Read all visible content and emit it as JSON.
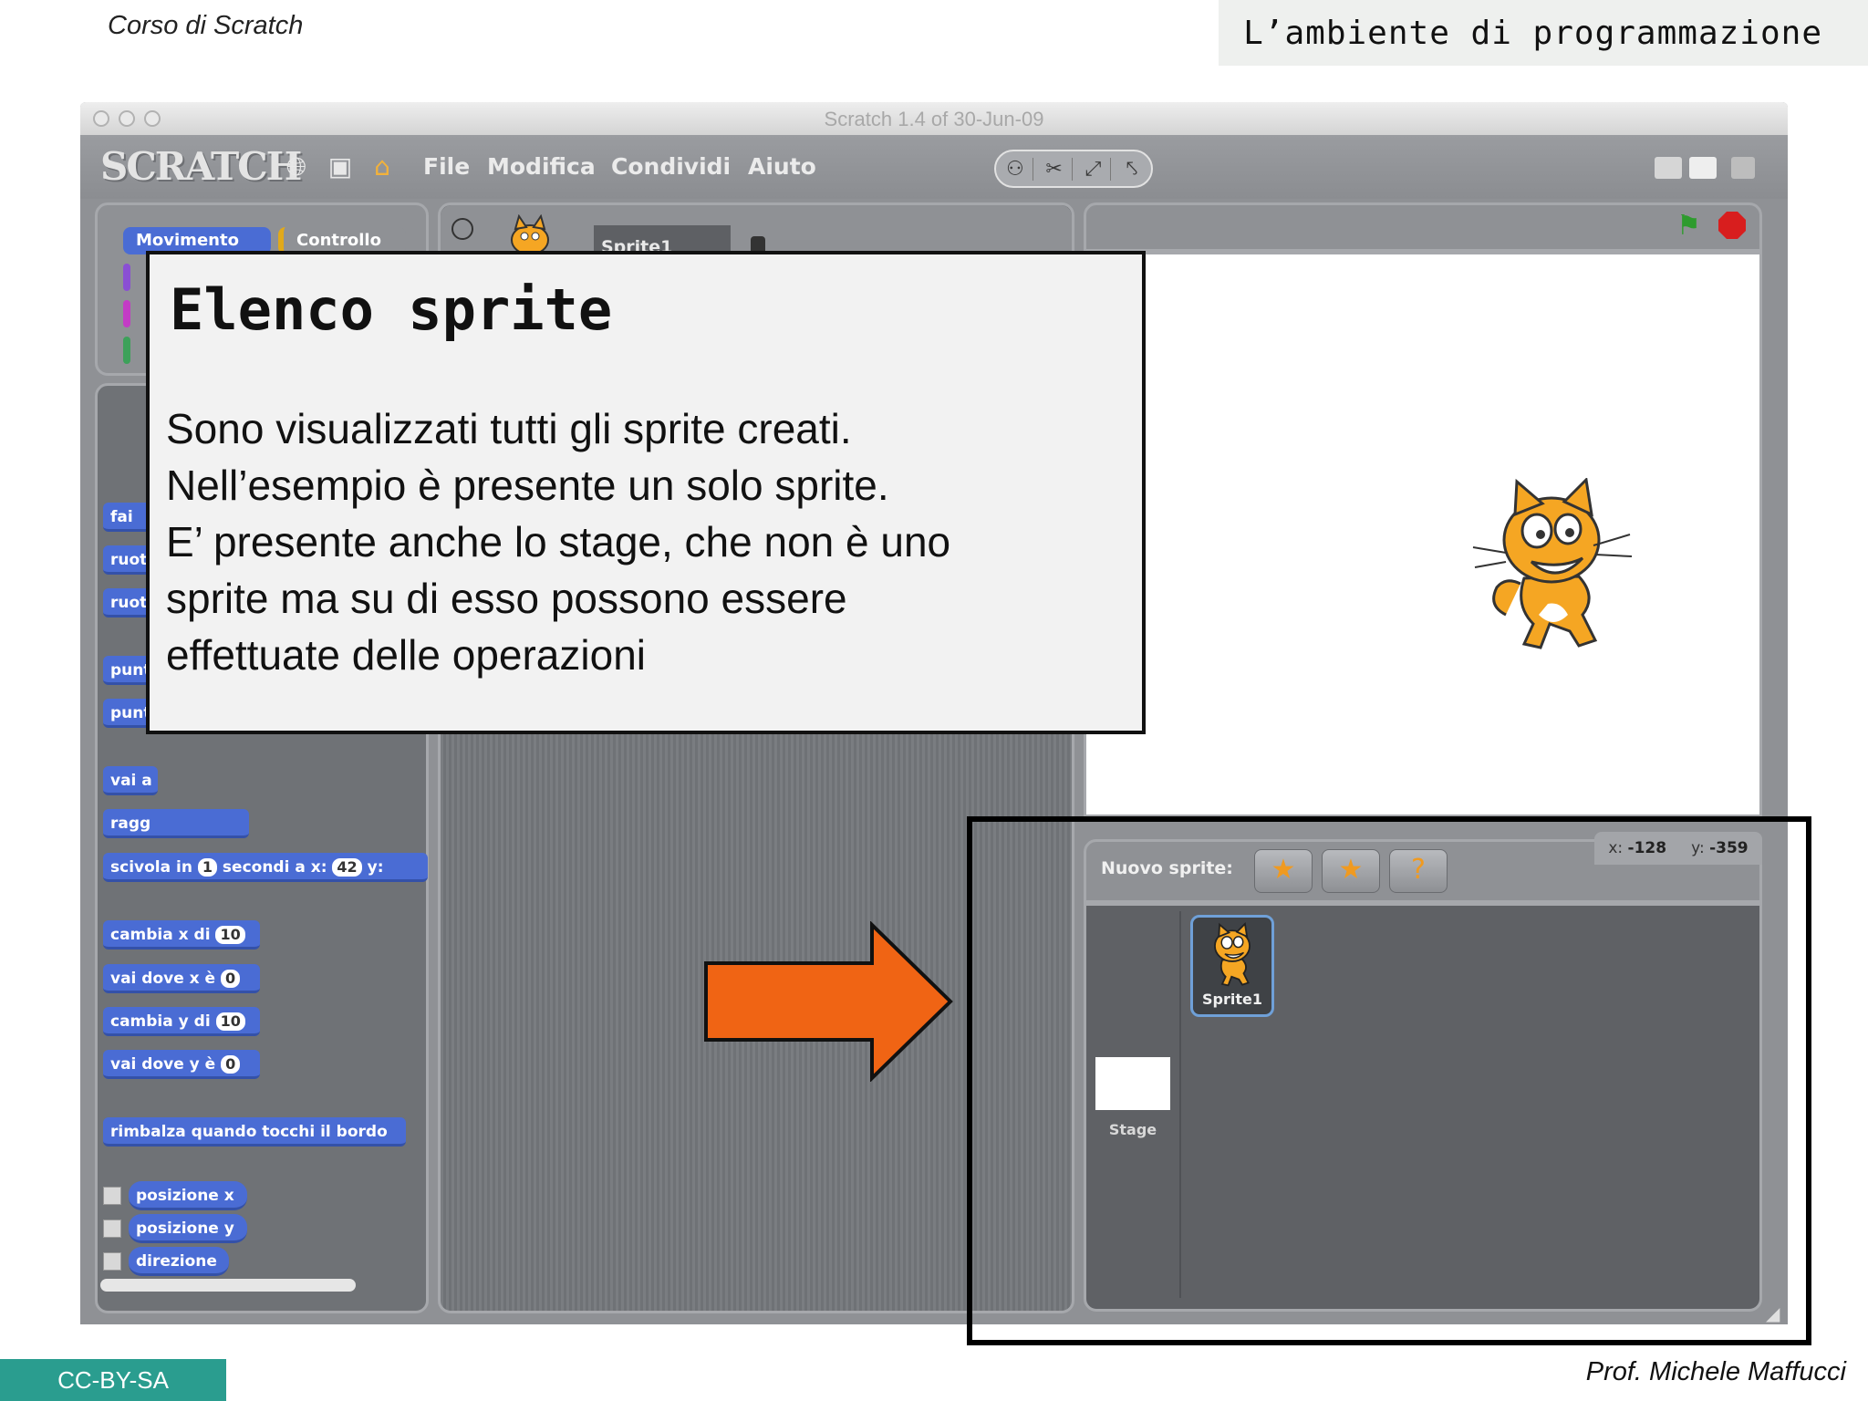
{
  "slide": {
    "course_title": "Corso di Scratch",
    "slide_title": "L’ambiente di programmazione",
    "license": "CC-BY-SA",
    "author": "Prof. Michele Maffucci"
  },
  "window": {
    "title": "Scratch 1.4 of 30-Jun-09"
  },
  "menubar": {
    "logo": "SCRATCH",
    "items": [
      "File",
      "Modifica",
      "Condividi",
      "Aiuto"
    ]
  },
  "palette": {
    "categories": [
      "Movimento",
      "Controllo"
    ],
    "blocks": [
      "fai",
      "ruot",
      "ruot",
      "punt",
      "punt",
      "vai a",
      "ragg",
      {
        "text": "scivola in",
        "n1": "1",
        "mid": "secondi a x:",
        "n2": "42",
        "end": "y:"
      },
      {
        "text": "cambia x di",
        "n": "10"
      },
      {
        "text": "vai dove x è",
        "n": "0"
      },
      {
        "text": "cambia y di",
        "n": "10"
      },
      {
        "text": "vai dove y è",
        "n": "0"
      },
      "rimbalza quando tocchi il bordo"
    ],
    "reporters": [
      "posizione x",
      "posizione y",
      "direzione"
    ]
  },
  "scripts_area": {
    "sprite_name": "Sprite1"
  },
  "sprite_panel": {
    "new_sprite_label": "Nuovo sprite:",
    "coords": {
      "x_label": "x:",
      "x": "-128",
      "y_label": "y:",
      "y": "-359"
    },
    "stage_label": "Stage",
    "sprite_label": "Sprite1"
  },
  "callout": {
    "title": "Elenco sprite",
    "lines": [
      "Sono visualizzati tutti gli sprite creati.",
      "Nell’esempio è presente un solo sprite.",
      "E’ presente anche lo stage, che non è uno",
      "sprite ma su di esso possono essere",
      "effettuate delle operazioni"
    ]
  },
  "colors": {
    "arrow": "#f06414",
    "motion_block": "#4a6cd4",
    "control_category": "#e1a91a",
    "license_bg": "#2a9d8f"
  }
}
